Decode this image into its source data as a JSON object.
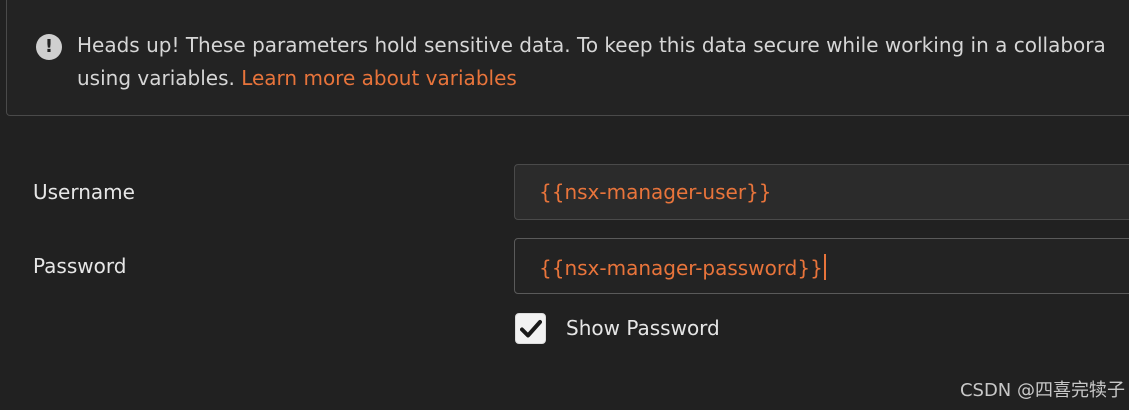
{
  "banner": {
    "icon": "exclamation-circle-icon",
    "icon_glyph": "!",
    "line1": "Heads up! These parameters hold sensitive data. To keep this data secure while working in a collabora",
    "line2_text": "using variables. ",
    "link_text": "Learn more about variables"
  },
  "form": {
    "username_label": "Username",
    "username_value": "{{nsx-manager-user}}",
    "password_label": "Password",
    "password_value": "{{nsx-manager-password}}",
    "show_password_label": "Show Password",
    "show_password_checked": true
  },
  "watermark": "CSDN @四喜完犊子",
  "colors": {
    "background": "#212121",
    "accent": "#e8743b",
    "text": "#e6e6e6"
  }
}
